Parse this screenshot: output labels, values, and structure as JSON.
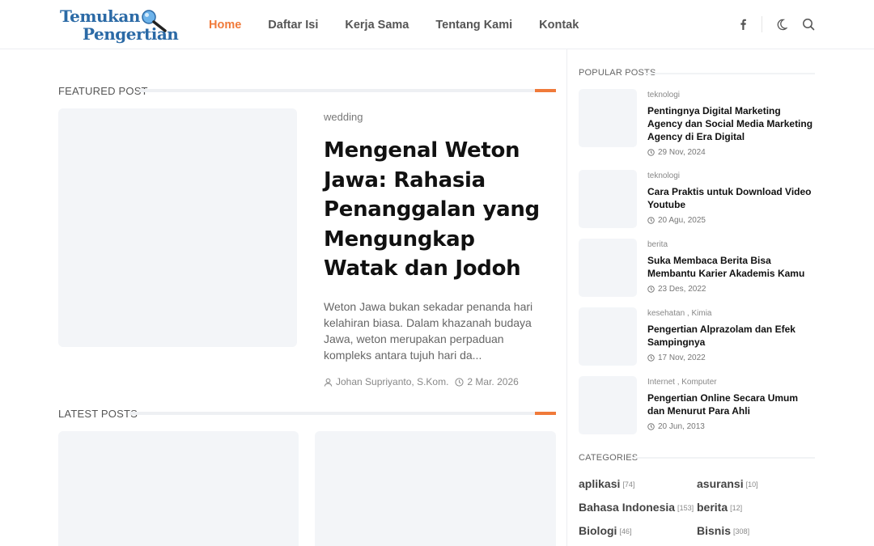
{
  "logo": {
    "line1": "Temukan",
    "line2": "Pengertian"
  },
  "nav": {
    "items": [
      {
        "label": "Home",
        "active": true
      },
      {
        "label": "Daftar Isi"
      },
      {
        "label": "Kerja Sama"
      },
      {
        "label": "Tentang Kami"
      },
      {
        "label": "Kontak"
      }
    ]
  },
  "header_icons": [
    "facebook-icon",
    "dark-mode-icon",
    "search-icon"
  ],
  "accent_color": "#f07a3a",
  "featured": {
    "section_title": "FEATURED POST",
    "label": "wedding",
    "title": "Mengenal Weton Jawa: Rahasia Penanggalan yang Mengungkap Watak dan Jodoh",
    "excerpt": "Weton Jawa bukan sekadar penanda hari kelahiran biasa. Dalam khazanah budaya Jawa, weton merupakan perpaduan kompleks antara tujuh hari da...",
    "author": "Johan Supriyanto, S.Kom.",
    "date": "2 Mar. 2026"
  },
  "latest": {
    "section_title": "LATEST POSTS"
  },
  "sidebar": {
    "popular_title": "POPULAR POSTS",
    "popular": [
      {
        "category": "teknologi",
        "title": "Pentingnya Digital Marketing Agency dan Social Media Marketing Agency di Era Digital",
        "date": "29 Nov, 2024"
      },
      {
        "category": "teknologi",
        "title": "Cara Praktis untuk Download Video Youtube",
        "date": "20 Agu, 2025"
      },
      {
        "category": "berita",
        "title": "Suka Membaca Berita Bisa Membantu Karier Akademis Kamu",
        "date": "23 Des, 2022"
      },
      {
        "category": "kesehatan , Kimia",
        "title": "Pengertian Alprazolam dan Efek Sampingnya",
        "date": "17 Nov, 2022"
      },
      {
        "category": "Internet , Komputer",
        "title": "Pengertian Online Secara Umum dan Menurut Para Ahli",
        "date": "20 Jun, 2013"
      }
    ],
    "categories_title": "CATEGORIES",
    "categories": [
      {
        "name": "aplikasi",
        "count": "74"
      },
      {
        "name": "asuransi",
        "count": "10"
      },
      {
        "name": "Bahasa Indonesia",
        "count": "153"
      },
      {
        "name": "berita",
        "count": "12"
      },
      {
        "name": "Biologi",
        "count": "46"
      },
      {
        "name": "Bisnis",
        "count": "308"
      }
    ]
  }
}
